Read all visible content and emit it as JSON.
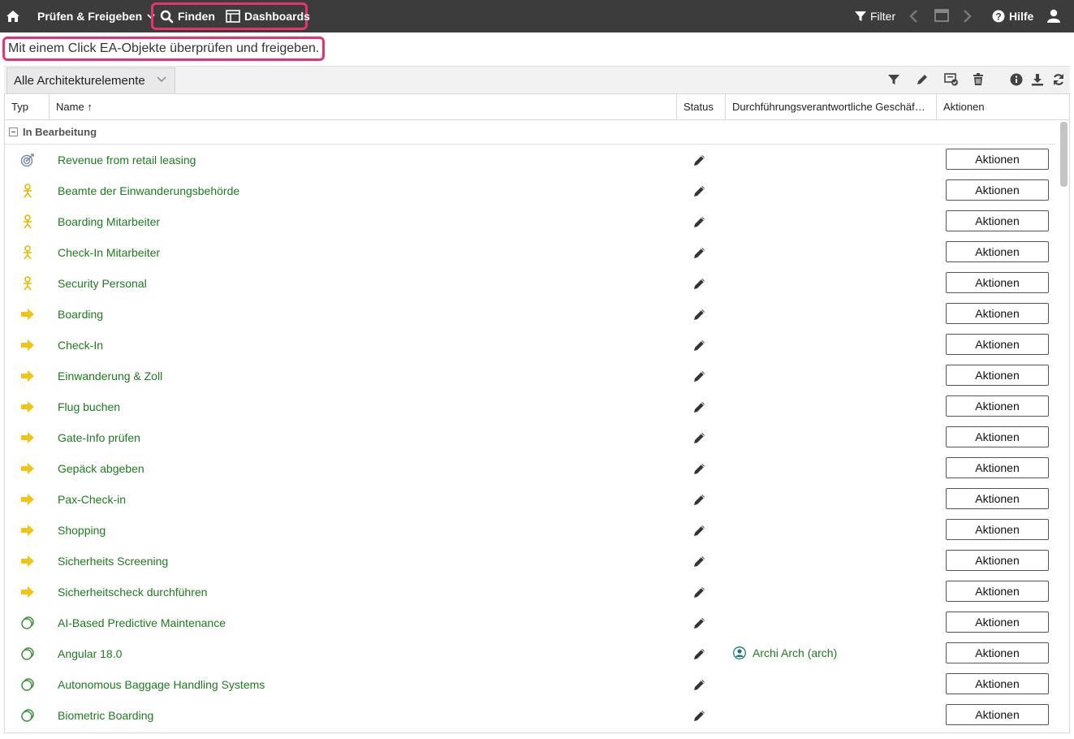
{
  "topbar": {
    "pruefen_label": "Prüfen & Freigeben",
    "finden_label": "Finden",
    "dashboards_label": "Dashboards",
    "filter_label": "Filter",
    "hilfe_label": "Hilfe"
  },
  "tagline": "Mit einem Click EA-Objekte überprüfen und freigeben.",
  "toolbar": {
    "view_select": "Alle Architekturelemente"
  },
  "table": {
    "columns": {
      "typ": "Typ",
      "name": "Name",
      "name_sort": "↑",
      "status": "Status",
      "dfv": "Durchführungsverantwortliche Geschäf…",
      "aktionen": "Aktionen"
    },
    "group_label": "In Bearbeitung",
    "action_label": "Aktionen",
    "rows": [
      {
        "type": "goal",
        "name": "Revenue from retail leasing",
        "owner": ""
      },
      {
        "type": "actor",
        "name": "Beamte der Einwanderungsbehörde",
        "owner": ""
      },
      {
        "type": "actor",
        "name": "Boarding Mitarbeiter",
        "owner": ""
      },
      {
        "type": "actor",
        "name": "Check-In Mitarbeiter",
        "owner": ""
      },
      {
        "type": "actor",
        "name": "Security Personal",
        "owner": ""
      },
      {
        "type": "process",
        "name": "Boarding",
        "owner": ""
      },
      {
        "type": "process",
        "name": "Check-In",
        "owner": ""
      },
      {
        "type": "process",
        "name": "Einwanderung & Zoll",
        "owner": ""
      },
      {
        "type": "process",
        "name": "Flug buchen",
        "owner": ""
      },
      {
        "type": "process",
        "name": "Gate-Info prüfen",
        "owner": ""
      },
      {
        "type": "process",
        "name": "Gepäck abgeben",
        "owner": ""
      },
      {
        "type": "process",
        "name": "Pax-Check-in",
        "owner": ""
      },
      {
        "type": "process",
        "name": "Shopping",
        "owner": ""
      },
      {
        "type": "process",
        "name": "Sicherheits Screening",
        "owner": ""
      },
      {
        "type": "process",
        "name": "Sicherheitscheck durchführen",
        "owner": ""
      },
      {
        "type": "technology",
        "name": "AI-Based Predictive Maintenance",
        "owner": ""
      },
      {
        "type": "technology",
        "name": "Angular 18.0",
        "owner": "Archi Arch (arch)"
      },
      {
        "type": "technology",
        "name": "Autonomous Baggage Handling Systems",
        "owner": ""
      },
      {
        "type": "technology",
        "name": "Biometric Boarding",
        "owner": ""
      }
    ]
  },
  "colors": {
    "topbar_bg": "#3c3c3c",
    "highlight": "#e8346c",
    "link_green": "#1e7a1e",
    "actor_yellow": "#e6b800",
    "process_yellow": "#f0c419",
    "goal_blue": "#7a8ca6",
    "tech_green": "#3f8f3f"
  }
}
